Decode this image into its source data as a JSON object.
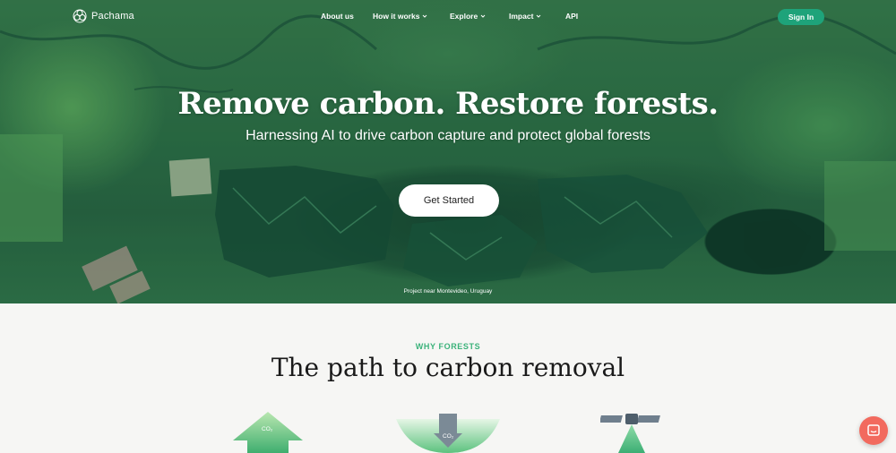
{
  "brand": {
    "name": "Pachama"
  },
  "nav": {
    "links": [
      {
        "label": "About us",
        "has_dropdown": false
      },
      {
        "label": "How it works",
        "has_dropdown": true
      },
      {
        "label": "Explore",
        "has_dropdown": true
      },
      {
        "label": "Impact",
        "has_dropdown": true
      },
      {
        "label": "API",
        "has_dropdown": false
      }
    ],
    "signin_label": "Sign In"
  },
  "hero": {
    "title": "Remove carbon. Restore forests.",
    "subtitle": "Harnessing AI to drive carbon capture and protect global forests",
    "cta_label": "Get Started",
    "caption": "Project near Montevideo, Uruguay"
  },
  "section": {
    "eyebrow": "WHY FORESTS",
    "title": "The path to carbon removal",
    "illustrations": [
      {
        "icon": "co2-up-arrow-icon",
        "label": "CO₂"
      },
      {
        "icon": "co2-down-arrow-icon",
        "label": "CO₂"
      },
      {
        "icon": "satellite-icon",
        "label": ""
      }
    ]
  },
  "colors": {
    "accent_green": "#1ea37a",
    "eyebrow_green": "#3bb27a",
    "chat_button": "#f26a5e",
    "section_bg": "#f6f6f4"
  }
}
